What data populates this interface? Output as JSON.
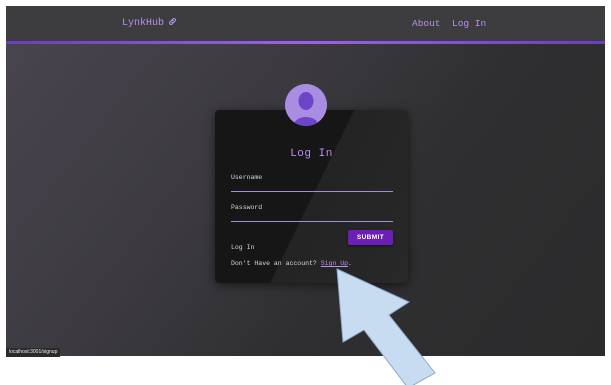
{
  "navbar": {
    "brand": "LynkHub",
    "brand_icon": "link-icon",
    "links": [
      "About",
      "Log In"
    ]
  },
  "card": {
    "avatar_icon": "user-avatar-icon",
    "title": "Log In",
    "fields": [
      {
        "label": "Username",
        "value": ""
      },
      {
        "label": "Password",
        "value": ""
      }
    ],
    "submit_label": "SUBMIT",
    "footer_title": "Log In",
    "signup_prompt": "Don't Have an account?",
    "signup_link": "Sign Up",
    "signup_suffix": "."
  },
  "status_bar": {
    "url": "localhost:3001/signup"
  },
  "colors": {
    "accent": "#b592ec",
    "button": "#6a1fb5",
    "card_bg": "#161616",
    "annotation_arrow": "#c7dcf0"
  }
}
